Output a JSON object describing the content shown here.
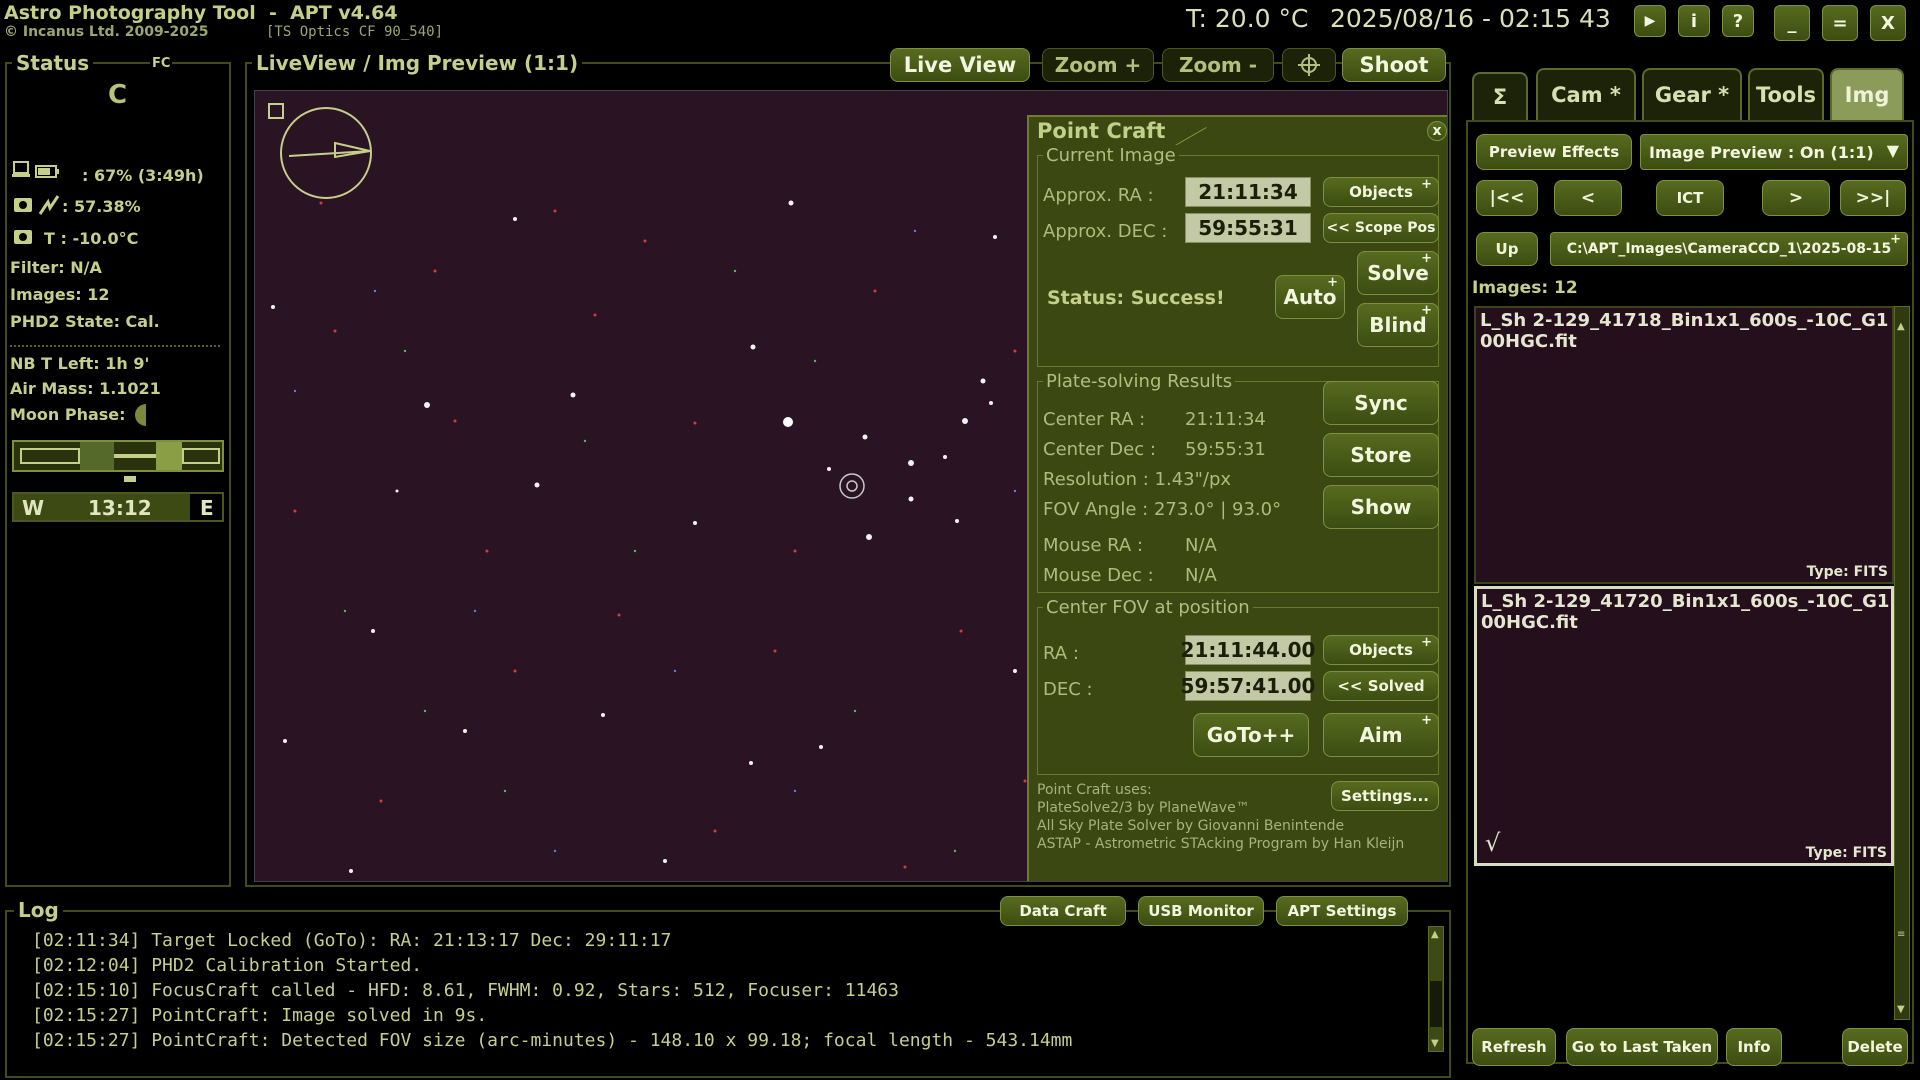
{
  "app": {
    "title": "Astro Photography Tool  -  APT v4.64",
    "copyright": "© Incanus Ltd. 2009-2025",
    "optics": "[TS Optics CF 90_540]",
    "temperature": "T: 20.0 °C",
    "datetime": "2025/08/16 - 02:15 43",
    "window_buttons": {
      "play": "▶",
      "info": "i",
      "help": "?",
      "minimize": "_",
      "maximize": "=",
      "close": "X"
    }
  },
  "status": {
    "title": "Status",
    "fc": "FC",
    "letter": "C",
    "battery": ": 67% (3:49h)",
    "cooler_power": ": 57.38%",
    "sensor_temp": "T : -10.0°C",
    "filter": "Filter: N/A",
    "images": "Images: 12",
    "phd2": "PHD2 State: Cal.",
    "nb_time": "NB T Left: 1h 9'",
    "air_mass": "Air Mass: 1.1021",
    "moon_phase": "Moon Phase:",
    "meridian_w": "W",
    "meridian_time": "13:12",
    "meridian_e": "E"
  },
  "liveview": {
    "title": "LiveView / Img Preview (1:1)",
    "buttons": {
      "live_view": "Live View",
      "zoom_in": "Zoom +",
      "zoom_out": "Zoom -",
      "shoot": "Shoot"
    }
  },
  "point_craft": {
    "title": "Point Craft",
    "close": "x",
    "current_image": {
      "title": "Current Image",
      "ra_label": "Approx. RA :",
      "ra_value": "21:11:34",
      "dec_label": "Approx. DEC :",
      "dec_value": "59:55:31",
      "objects_btn": "Objects",
      "scope_pos_btn": "<< Scope Pos",
      "status": "Status: Success!",
      "auto_btn": "Auto",
      "solve_btn": "Solve",
      "blind_btn": "Blind"
    },
    "results": {
      "title": "Plate-solving Results",
      "center_ra_label": "Center RA :",
      "center_ra": "21:11:34",
      "center_dec_label": "Center Dec :",
      "center_dec": "59:55:31",
      "resolution": "Resolution : 1.43\"/px",
      "fov_angle": "FOV Angle : 273.0° | 93.0°",
      "mouse_ra_label": "Mouse RA :",
      "mouse_ra": "N/A",
      "mouse_dec_label": "Mouse Dec :",
      "mouse_dec": "N/A",
      "sync_btn": "Sync",
      "store_btn": "Store",
      "show_btn": "Show"
    },
    "center_fov": {
      "title": "Center FOV at position",
      "ra_label": "RA :",
      "ra_value": "21:11:44.00",
      "dec_label": "DEC :",
      "dec_value": "59:57:41.00",
      "objects_btn": "Objects",
      "solved_btn": "<< Solved",
      "goto_btn": "GoTo++",
      "aim_btn": "Aim"
    },
    "footer": {
      "line1": "Point Craft uses:",
      "line2": "PlateSolve2/3 by PlaneWave™",
      "line3": "All Sky Plate Solver by Giovanni Benintende",
      "line4": "ASTAP - Astrometric STAcking Program by Han Kleijn",
      "settings_btn": "Settings..."
    }
  },
  "log": {
    "title": "Log",
    "buttons": {
      "data_craft": "Data Craft",
      "usb_monitor": "USB Monitor",
      "apt_settings": "APT Settings"
    },
    "lines": [
      "[02:11:34] Target Locked (GoTo): RA: 21:13:17 Dec: 29:11:17",
      "[02:12:04] PHD2 Calibration Started.",
      "[02:15:10] FocusCraft called - HFD: 8.61, FWHM: 0.92, Stars: 512, Focuser: 11463",
      "[02:15:27] PointCraft: Image solved in 9s.",
      "[02:15:27] PointCraft: Detected FOV size (arc-minutes) - 148.10 x 99.18; focal length - 543.14mm"
    ]
  },
  "right_panel": {
    "tabs": {
      "sigma": "Σ",
      "cam": "Cam *",
      "gear": "Gear *",
      "tools": "Tools",
      "img": "Img"
    },
    "preview_effects": "Preview Effects",
    "image_preview_select": "Image Preview : On (1:1)",
    "nav": {
      "first": "|<<",
      "prev": "<",
      "ict": "ICT",
      "next": ">",
      "last": ">>|"
    },
    "up": "Up",
    "path": "C:\\APT_Images\\CameraCCD_1\\2025-08-15",
    "images_count": "Images: 12",
    "files": [
      {
        "name": "L_Sh 2-129_41718_Bin1x1_600s_-10C_G100HGC.fit",
        "type": "Type: FITS"
      },
      {
        "name": "L_Sh 2-129_41720_Bin1x1_600s_-10C_G100HGC.fit",
        "type": "Type: FITS",
        "check": "√"
      }
    ],
    "bottom_buttons": {
      "refresh": "Refresh",
      "go_last": "Go to Last Taken",
      "info": "Info",
      "delete": "Delete"
    }
  },
  "colors": {
    "accent": "#4e621a",
    "panel": "#3b4812",
    "text": "#c4cf8a",
    "sky": "#2a1322"
  }
}
